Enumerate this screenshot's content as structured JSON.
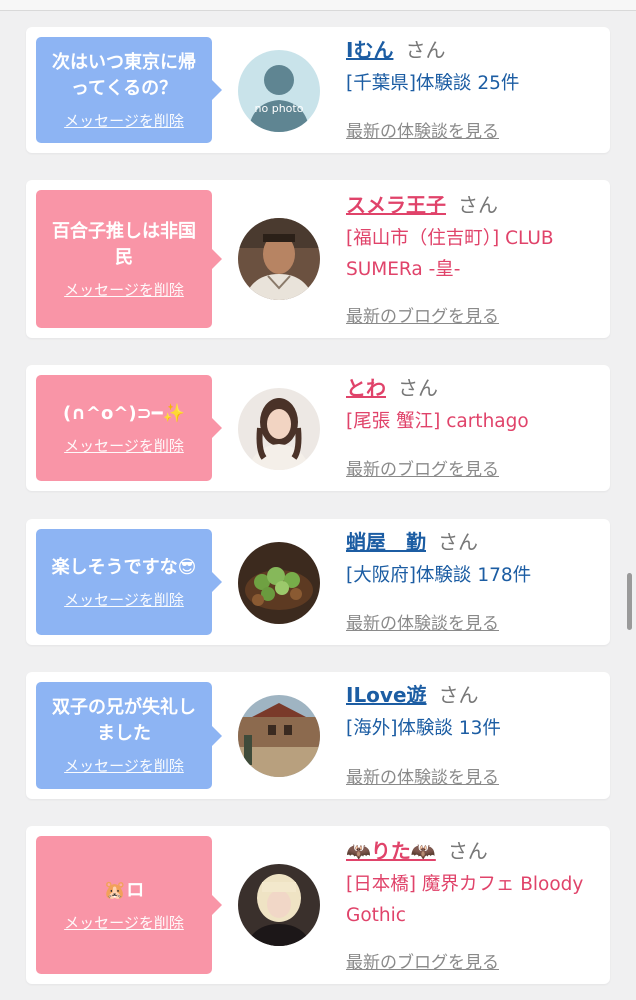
{
  "entries": [
    {
      "message": "次はいつ東京に帰ってくるの？",
      "delete_label": "メッセージを削除",
      "bubble_color": "#8db4f3",
      "name": "Iむん",
      "honorific": "さん",
      "subtitle": "[千葉県]体験談 25件",
      "link": "最新の体験談を見る",
      "avatar": "no-photo-silhouette",
      "avatar_text": "no photo"
    },
    {
      "message": "百合子推しは非国民",
      "delete_label": "メッセージを削除",
      "bubble_color": "#f995a7",
      "name": "スメラ王子",
      "honorific": "さん",
      "subtitle": "[福山市（住吉町）] CLUB SUMERa -皇-",
      "link": "最新のブログを見る",
      "avatar": "man-portrait-photo"
    },
    {
      "message": "(∩^o^)⊃━☆ﾟ.*･｡",
      "message_display": "(∩^o^)⊃━✨",
      "delete_label": "メッセージを削除",
      "bubble_color": "#f995a7",
      "name": "とわ",
      "honorific": "さん",
      "subtitle": "[尾張 蟹江] carthago",
      "link": "最新のブログを見る",
      "avatar": "woman-portrait-photo"
    },
    {
      "message": "楽しそうですな😎",
      "delete_label": "メッセージを削除",
      "bubble_color": "#8db4f3",
      "name": "蛸屋　勤",
      "honorific": "さん",
      "subtitle": "[大阪府]体験談 178件",
      "link": "最新の体験談を見る",
      "avatar": "food-photo"
    },
    {
      "message": "双子の兄が失礼しました",
      "delete_label": "メッセージを削除",
      "bubble_color": "#8db4f3",
      "name": "ILove遊",
      "honorific": "さん",
      "subtitle": "[海外]体験談 13件",
      "link": "最新の体験談を見る",
      "avatar": "street-scene-photo"
    },
    {
      "message": "🐹ロ",
      "delete_label": "メッセージを削除",
      "bubble_color": "#f995a7",
      "name": "🦇りた🦇",
      "honorific": "さん",
      "subtitle": "[日本橋] 魔界カフェ Bloody Gothic",
      "link": "最新のブログを見る",
      "avatar": "blonde-woman-photo"
    }
  ]
}
